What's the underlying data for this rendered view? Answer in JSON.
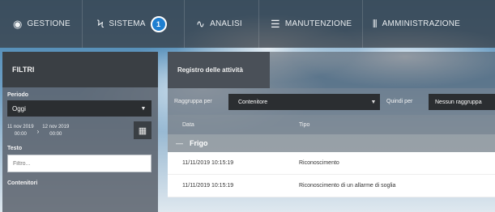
{
  "nav": {
    "items": [
      {
        "label": "GESTIONE",
        "icon": "eye-icon"
      },
      {
        "label": "SISTEMA",
        "icon": "lightning-icon",
        "badge": "1"
      },
      {
        "label": "ANALISI",
        "icon": "line-chart-icon"
      },
      {
        "label": "MANUTENZIONE",
        "icon": "list-icon"
      },
      {
        "label": "AMMINISTRAZIONE",
        "icon": "sliders-icon"
      }
    ],
    "badge_color": "#1e7fd1"
  },
  "filters": {
    "title": "FILTRI",
    "periodo_label": "Periodo",
    "periodo_value": "Oggi",
    "date_from": {
      "date": "11 nov 2019",
      "time": "00:00"
    },
    "date_to": {
      "date": "12 nov 2019",
      "time": "00:00"
    },
    "testo_label": "Testo",
    "testo_placeholder": "Filtro...",
    "contenitori_label": "Contenitori"
  },
  "main": {
    "tab_label": "Registro delle attività",
    "group_by_label": "Raggruppa per",
    "group_by_value": "Contenitore",
    "then_by_label": "Quindi per",
    "then_by_value": "Nessun raggruppa",
    "columns": {
      "data": "Data",
      "tipo": "Tipo"
    },
    "group_name": "Frigo",
    "rows": [
      {
        "data": "11/11/2019 10:15:19",
        "tipo": "Riconoscimento"
      },
      {
        "data": "11/11/2019 10:15:19",
        "tipo": "Riconoscimento di un allarme di soglia"
      }
    ]
  }
}
